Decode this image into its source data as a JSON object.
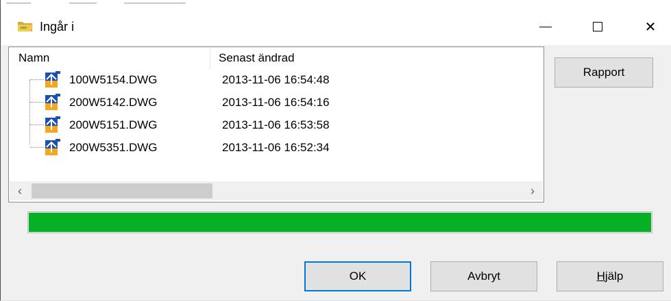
{
  "window": {
    "title": "Ingår i",
    "minimize_icon": "minimize-icon",
    "maximize_icon": "maximize-icon",
    "close_icon": "close-icon",
    "close_glyph": "✕"
  },
  "list": {
    "columns": [
      "Namn",
      "Senast ändrad"
    ],
    "rows": [
      {
        "name": "100W5154.DWG",
        "modified": "2013-11-06 16:54:48"
      },
      {
        "name": "200W5142.DWG",
        "modified": "2013-11-06 16:54:16"
      },
      {
        "name": "200W5151.DWG",
        "modified": "2013-11-06 16:53:58"
      },
      {
        "name": "200W5351.DWG",
        "modified": "2013-11-06 16:52:34"
      }
    ],
    "scroll_left_glyph": "‹",
    "scroll_right_glyph": "›"
  },
  "progress": {
    "value_fraction": 1.0,
    "color": "#06b025"
  },
  "buttons": {
    "report": "Rapport",
    "ok": "OK",
    "cancel": "Avbryt",
    "help_underlined": "H",
    "help_rest": "jälp"
  },
  "colors": {
    "accent": "#0078d7",
    "progress_fill": "#06b025",
    "dialog_bg": "#f0f0f0"
  }
}
